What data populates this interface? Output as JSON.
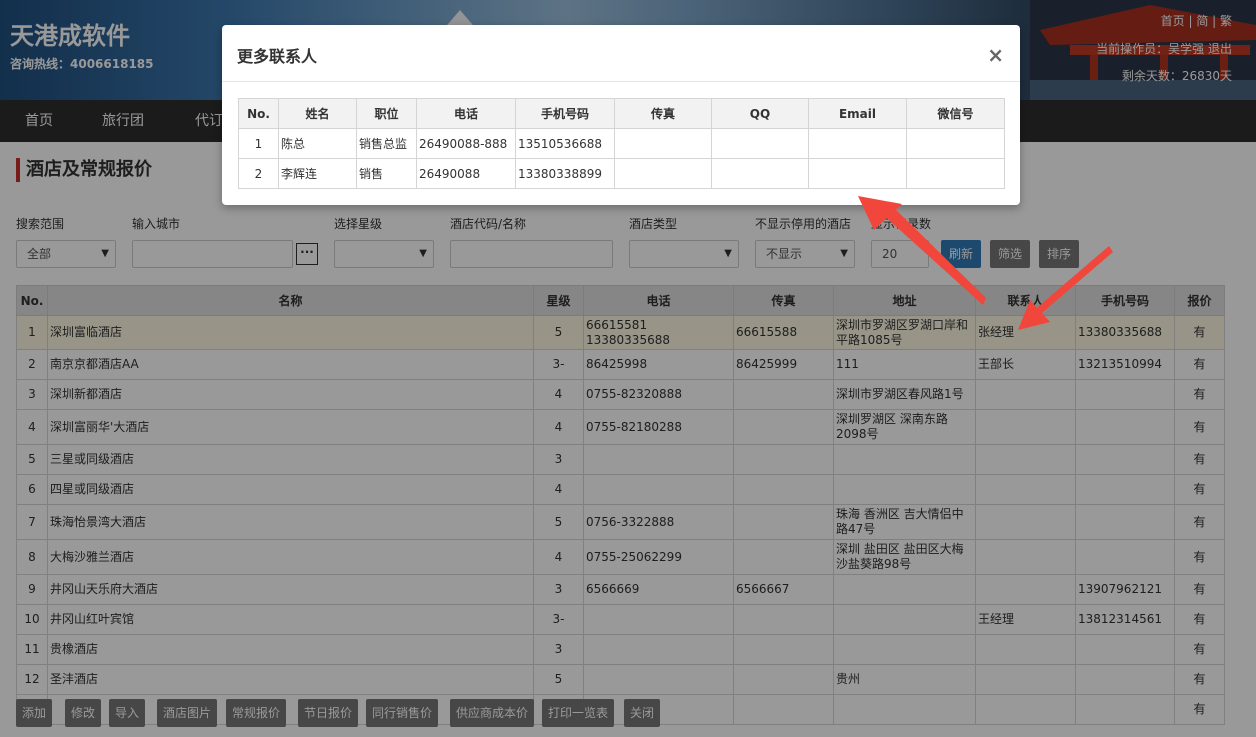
{
  "header": {
    "brand": "天港成软件",
    "hotline": "咨询热线：4006618185",
    "top_links": "首页 | 简 | 繁",
    "operator": "当前操作员：吴学强 退出",
    "days_left": "剩余天数：26830天"
  },
  "nav": {
    "items": [
      "首页",
      "旅行团",
      "代订"
    ]
  },
  "page_title": "酒店及常规报价",
  "filters": {
    "scope_label": "搜索范围",
    "scope_value": "全部",
    "city_label": "输入城市",
    "city_value": "",
    "dots_label": "···",
    "star_label": "选择星级",
    "code_label": "酒店代码/名称",
    "type_label": "酒店类型",
    "disabled_label": "不显示停用的酒店",
    "disabled_value": "不显示",
    "count_label": "显示记录数",
    "count_value": "20",
    "refresh": "刷新",
    "filter": "筛选",
    "sort": "排序"
  },
  "table": {
    "headers": [
      "No.",
      "名称",
      "星级",
      "电话",
      "传真",
      "地址",
      "联系人",
      "手机号码",
      "报价"
    ],
    "rows": [
      [
        "1",
        "深圳富临酒店",
        "5",
        "66615581 13380335688",
        "66615588",
        "深圳市罗湖区罗湖口岸和平路1085号",
        "张经理",
        "13380335688",
        "有"
      ],
      [
        "2",
        "南京京都酒店AA",
        "3-",
        "86425998",
        "86425999",
        "111",
        "王部长",
        "13213510994",
        "有"
      ],
      [
        "3",
        "深圳新都酒店",
        "4",
        "0755-82320888",
        "",
        "深圳市罗湖区春风路1号",
        "",
        "",
        "有"
      ],
      [
        "4",
        "深圳富丽华'大酒店",
        "4",
        "0755-82180288",
        "",
        "深圳罗湖区 深南东路2098号",
        "",
        "",
        "有"
      ],
      [
        "5",
        "三星或同级酒店",
        "3",
        "",
        "",
        "",
        "",
        "",
        "有"
      ],
      [
        "6",
        "四星或同级酒店",
        "4",
        "",
        "",
        "",
        "",
        "",
        "有"
      ],
      [
        "7",
        "珠海怡景湾大酒店",
        "5",
        "0756-3322888",
        "",
        "珠海 香洲区 吉大情侣中路47号",
        "",
        "",
        "有"
      ],
      [
        "8",
        "大梅沙雅兰酒店",
        "4",
        "0755-25062299",
        "",
        "深圳 盐田区 盐田区大梅沙盐葵路98号",
        "",
        "",
        "有"
      ],
      [
        "9",
        "井冈山天乐府大酒店",
        "3",
        "6566669",
        "6566667",
        "",
        "",
        "13907962121",
        "有"
      ],
      [
        "10",
        "井冈山红叶宾馆",
        "3-",
        "",
        "",
        "",
        "王经理",
        "13812314561",
        "有"
      ],
      [
        "11",
        "贵橡酒店",
        "3",
        "",
        "",
        "",
        "",
        "",
        "有"
      ],
      [
        "12",
        "圣沣酒店",
        "5",
        "",
        "",
        "贵州",
        "",
        "",
        "有"
      ],
      [
        "13",
        "",
        "",
        "",
        "",
        "",
        "",
        "",
        "有"
      ]
    ]
  },
  "toolbar": {
    "buttons": [
      "添加",
      "修改",
      "导入",
      "酒店图片",
      "常规报价",
      "节日报价",
      "同行销售价",
      "供应商成本价",
      "打印一览表",
      "关闭"
    ]
  },
  "modal": {
    "title": "更多联系人",
    "close": "×",
    "headers": [
      "No.",
      "姓名",
      "职位",
      "电话",
      "手机号码",
      "传真",
      "QQ",
      "Email",
      "微信号"
    ],
    "rows": [
      [
        "1",
        "陈总",
        "销售总监",
        "26490088-888",
        "13510536688",
        "",
        "",
        "",
        ""
      ],
      [
        "2",
        "李辉连",
        "销售",
        "26490088",
        "13380338899",
        "",
        "",
        "",
        ""
      ]
    ]
  },
  "colors": {
    "nav_bg": "#2d2d2d",
    "accent_red": "#c9302c",
    "button_blue": "#337ab7",
    "button_gray": "#777777",
    "arrow_red": "#f0463c"
  }
}
